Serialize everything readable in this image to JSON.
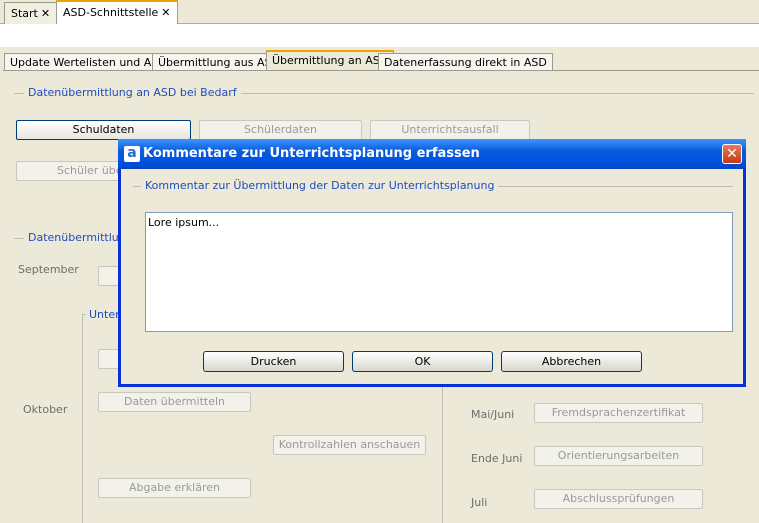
{
  "window_tabs": [
    {
      "label": "Start"
    },
    {
      "label": "ASD-Schnittstelle"
    }
  ],
  "page_tabs": [
    {
      "label": "Update Wertelisten und ASV"
    },
    {
      "label": "Übermittlung aus ASD"
    },
    {
      "label": "Übermittlung an ASD"
    },
    {
      "label": "Datenerfassung direkt in ASD"
    }
  ],
  "section1": {
    "title": "Datenübermittlung an ASD bei Bedarf",
    "buttons": [
      "Schuldaten",
      "Schülerdaten",
      "Unterrichtsausfall"
    ],
    "partial_button": "Schüler über"
  },
  "section2": {
    "title_partial": "Datenübermittlung",
    "month_september": "September",
    "group_partial": "Unterr",
    "month_oktober": "Oktober",
    "btn_daten_uebermitteln": "Daten übermitteln",
    "btn_kontrollzahlen": "Kontrollzahlen anschauen",
    "btn_abgabe": "Abgabe erklären",
    "right_rows": [
      {
        "label": "Mai/Juni",
        "button": "Fremdsprachenzertifikat"
      },
      {
        "label": "Ende Juni",
        "button": "Orientierungsarbeiten"
      },
      {
        "label": "Juli",
        "button": "Abschlussprüfungen"
      }
    ]
  },
  "dialog": {
    "logo": "a",
    "title": "Kommentare zur Unterrichtsplanung erfassen",
    "group_title": "Kommentar zur Übermittlung der Daten zur Unterrichtsplanung",
    "text_value": "Lore ipsum...",
    "buttons": {
      "print": "Drucken",
      "ok": "OK",
      "cancel": "Abbrechen"
    }
  },
  "colors": {
    "title_bar": "#0054e3",
    "section_title": "#1f4bc0",
    "active_tab_accent": "#f0a000",
    "close_button": "#c13a16"
  }
}
